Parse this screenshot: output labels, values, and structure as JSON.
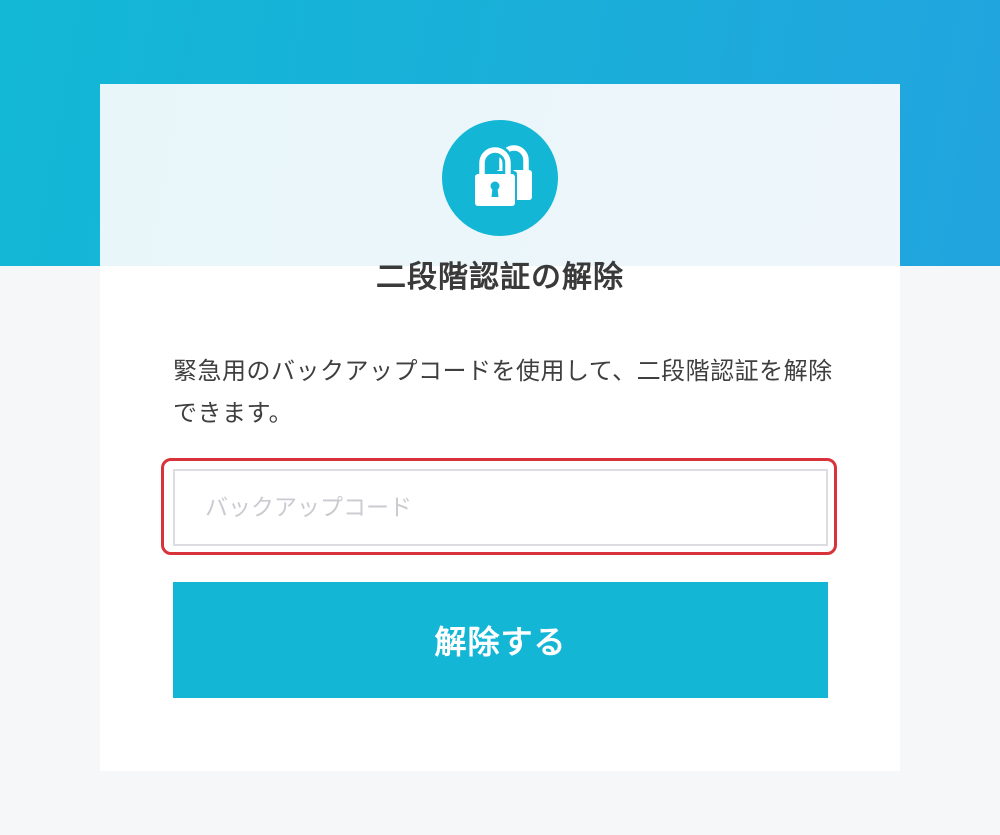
{
  "brand": {
    "accent": "#14b6d6",
    "highlight": "#d8333a"
  },
  "header": {
    "icon": "lock-icon",
    "title": "二段階認証の解除"
  },
  "main": {
    "description": "緊急用のバックアップコードを使用して、二段階認証を解除できます。",
    "backup_code": {
      "value": "",
      "placeholder": "バックアップコード"
    },
    "submit_label": "解除する"
  }
}
